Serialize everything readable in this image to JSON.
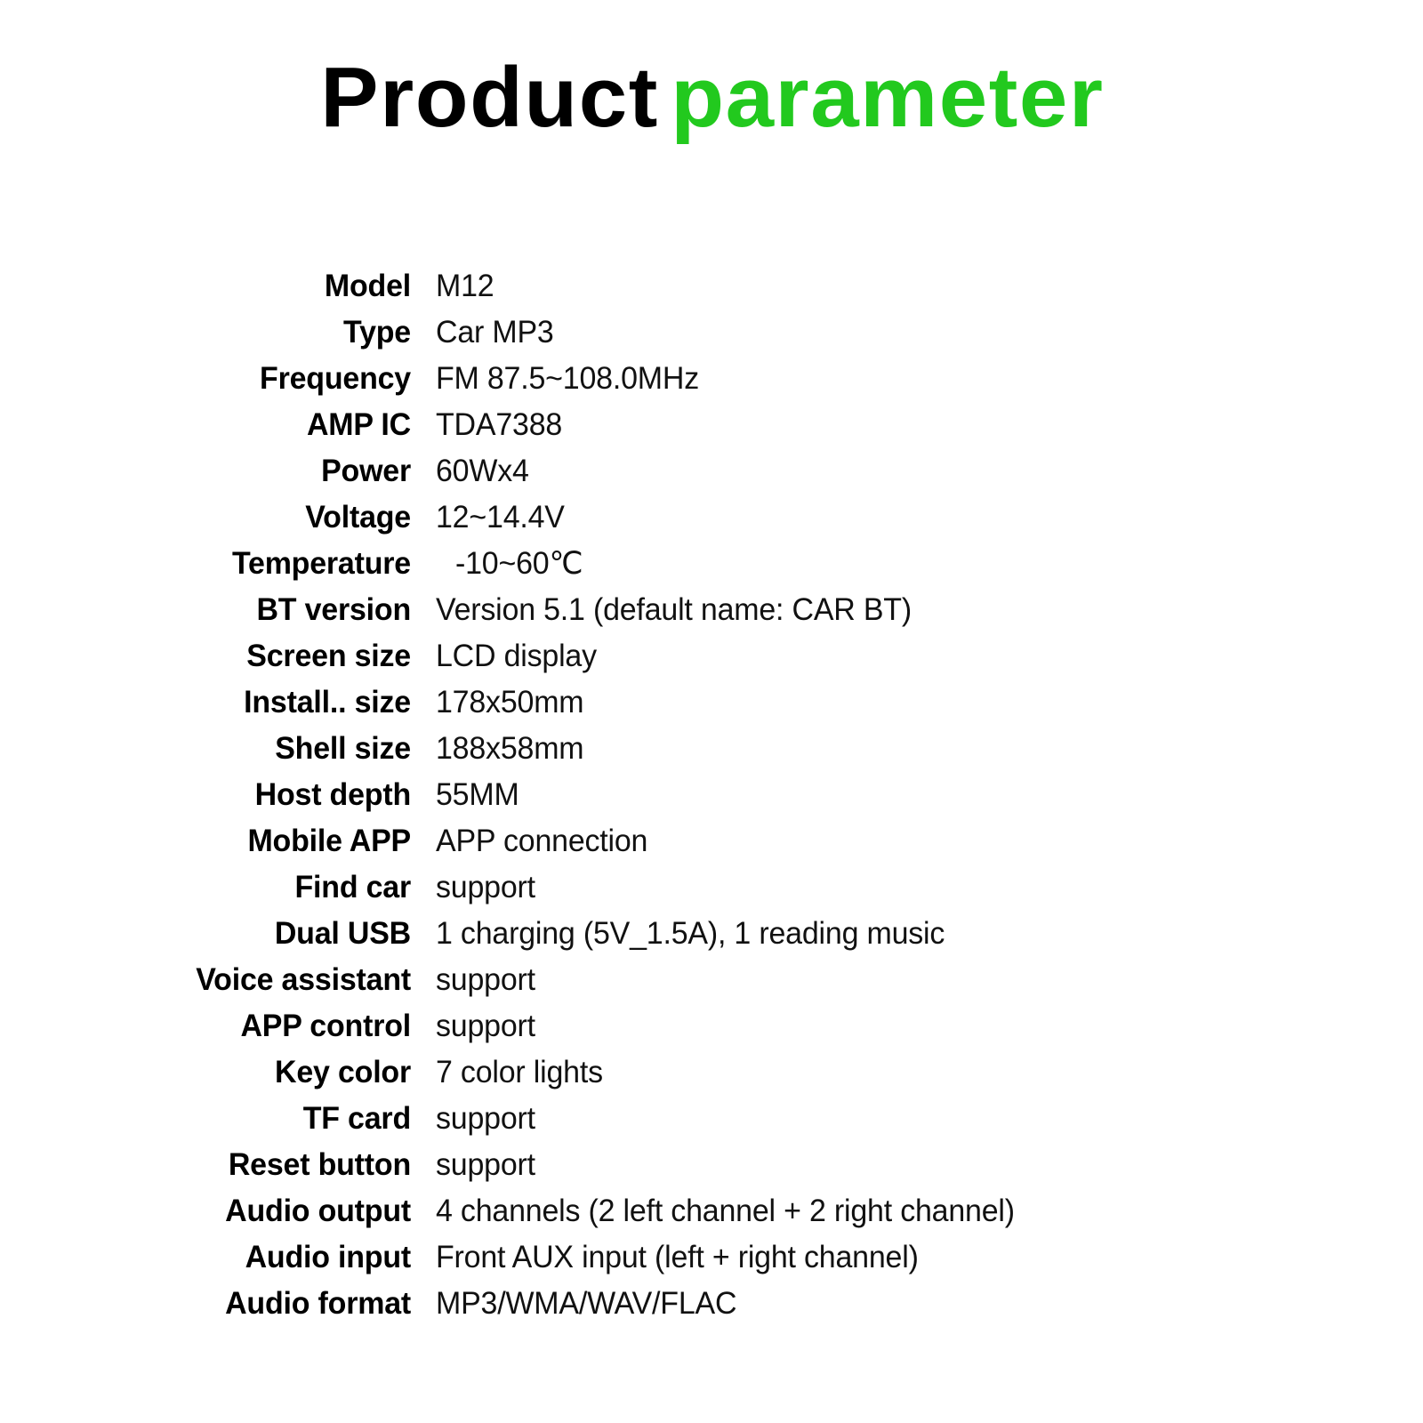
{
  "title": {
    "part1": "Product",
    "part2": "parameter",
    "part1_color": "#000000",
    "part2_color": "#22c91e"
  },
  "spec_table": {
    "rows": [
      {
        "label": "Model",
        "value": "M12"
      },
      {
        "label": "Type",
        "value": "Car MP3"
      },
      {
        "label": "Frequency",
        "value": "FM 87.5~108.0MHz"
      },
      {
        "label": "AMP IC",
        "value": "TDA7388"
      },
      {
        "label": "Power",
        "value": "60Wx4"
      },
      {
        "label": "Voltage",
        "value": "12~14.4V"
      },
      {
        "label": "Temperature",
        "value": "-10~60℃",
        "indent": true
      },
      {
        "label": "BT version",
        "value": "Version 5.1 (default name: CAR BT)"
      },
      {
        "label": "Screen size",
        "value": "LCD display"
      },
      {
        "label": "Install.. size",
        "value": "178x50mm"
      },
      {
        "label": "Shell size",
        "value": "188x58mm"
      },
      {
        "label": "Host depth",
        "value": "55MM"
      },
      {
        "label": "Mobile APP",
        "value": "APP connection"
      },
      {
        "label": "Find car",
        "value": "support"
      },
      {
        "label": "Dual USB",
        "value": "1 charging (5V_1.5A), 1 reading music"
      },
      {
        "label": "Voice assistant",
        "value": "support"
      },
      {
        "label": "APP control",
        "value": "support"
      },
      {
        "label": "Key color",
        "value": "7 color lights"
      },
      {
        "label": "TF card",
        "value": "support"
      },
      {
        "label": "Reset button",
        "value": "support"
      },
      {
        "label": "Audio output",
        "value": "4 channels (2 left channel + 2 right channel)"
      },
      {
        "label": "Audio input",
        "value": "Front AUX input (left + right channel)"
      },
      {
        "label": "Audio format",
        "value": "MP3/WMA/WAV/FLAC"
      }
    ]
  }
}
